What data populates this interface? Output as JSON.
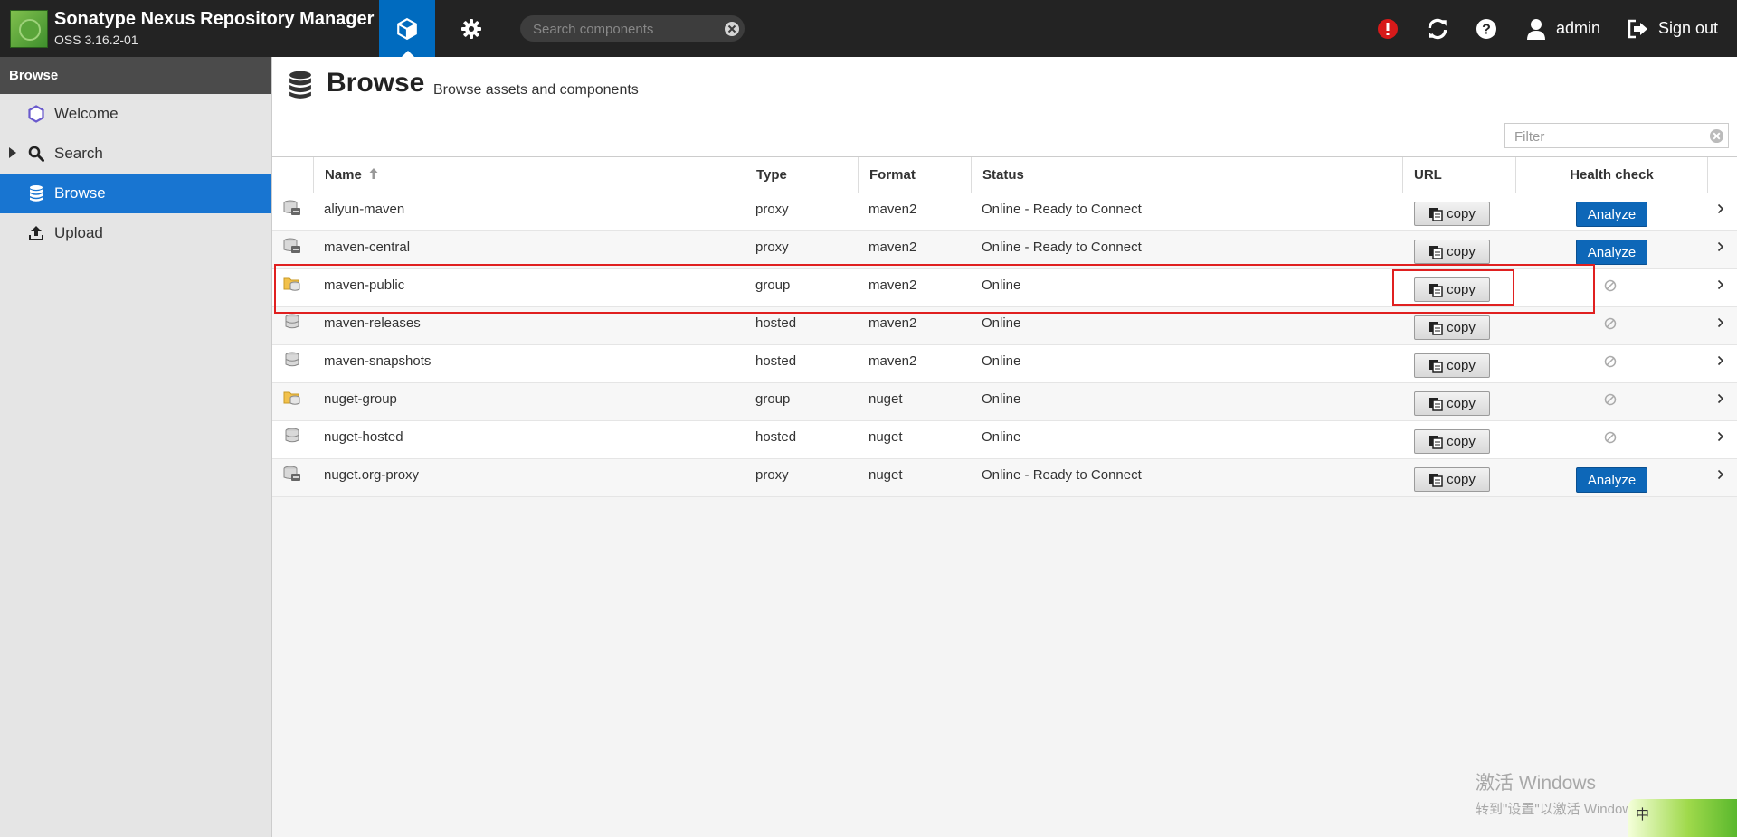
{
  "header": {
    "app_title": "Sonatype Nexus Repository Manager",
    "app_version": "OSS 3.16.2-01",
    "search_placeholder": "Search components",
    "user_label": "admin",
    "signout_label": "Sign out"
  },
  "sidebar": {
    "heading": "Browse",
    "items": [
      {
        "label": "Welcome",
        "icon": "hexagon-icon"
      },
      {
        "label": "Search",
        "icon": "magnifier-icon"
      },
      {
        "label": "Browse",
        "icon": "database-icon"
      },
      {
        "label": "Upload",
        "icon": "upload-icon"
      }
    ]
  },
  "main": {
    "title": "Browse",
    "subtitle": "Browse assets and components",
    "filter_placeholder": "Filter"
  },
  "grid": {
    "columns": {
      "name": "Name",
      "type": "Type",
      "format": "Format",
      "status": "Status",
      "url": "URL",
      "health": "Health check"
    },
    "copy_label": "copy",
    "analyze_label": "Analyze",
    "rows": [
      {
        "name": "aliyun-maven",
        "type": "proxy",
        "format": "maven2",
        "status": "Online - Ready to Connect",
        "health": "analyze"
      },
      {
        "name": "maven-central",
        "type": "proxy",
        "format": "maven2",
        "status": "Online - Ready to Connect",
        "health": "analyze"
      },
      {
        "name": "maven-public",
        "type": "group",
        "format": "maven2",
        "status": "Online",
        "health": "na"
      },
      {
        "name": "maven-releases",
        "type": "hosted",
        "format": "maven2",
        "status": "Online",
        "health": "na"
      },
      {
        "name": "maven-snapshots",
        "type": "hosted",
        "format": "maven2",
        "status": "Online",
        "health": "na"
      },
      {
        "name": "nuget-group",
        "type": "group",
        "format": "nuget",
        "status": "Online",
        "health": "na"
      },
      {
        "name": "nuget-hosted",
        "type": "hosted",
        "format": "nuget",
        "status": "Online",
        "health": "na"
      },
      {
        "name": "nuget.org-proxy",
        "type": "proxy",
        "format": "nuget",
        "status": "Online - Ready to Connect",
        "health": "analyze"
      }
    ]
  },
  "watermark": {
    "title": "激活 Windows",
    "subtitle": "转到\"设置\"以激活 Windows。"
  },
  "ime": {
    "label": "中"
  },
  "colors": {
    "header_bg": "#232323",
    "accent_blue": "#006bbf",
    "nav_active": "#1875d1",
    "analyze_bg": "#0d67b8",
    "alert_red": "#d71a1a",
    "highlight_red": "#e02020"
  }
}
